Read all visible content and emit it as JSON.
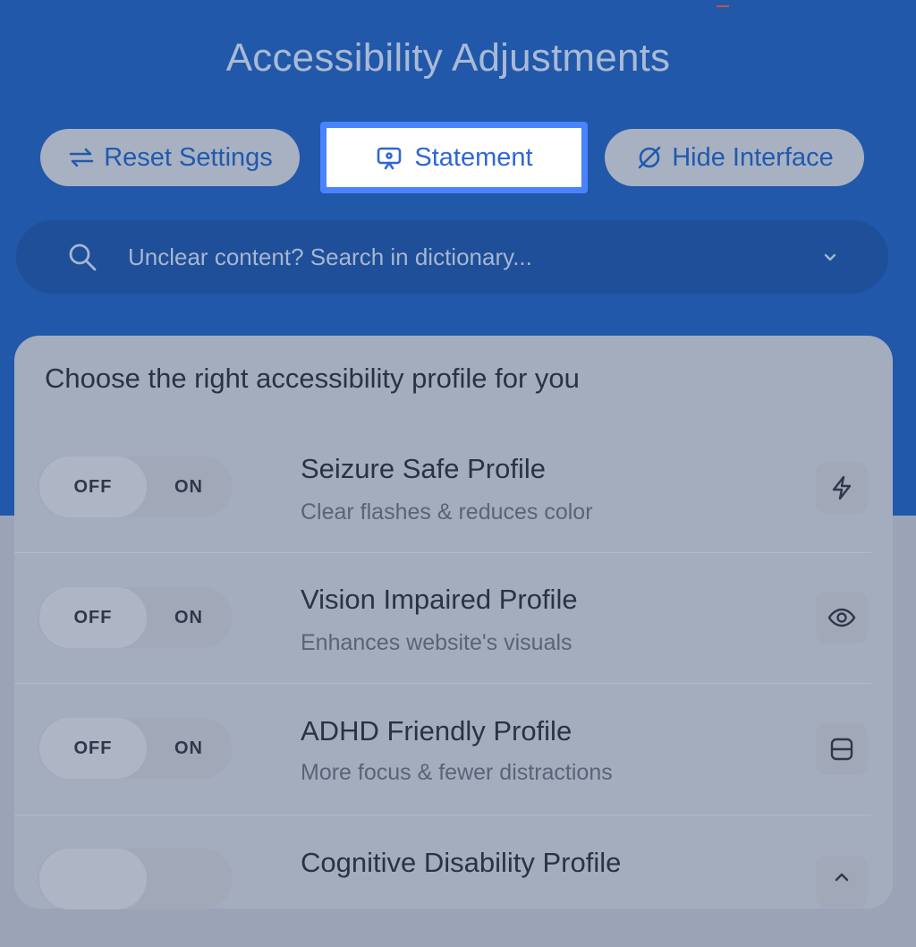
{
  "header": {
    "title": "Accessibility Adjustments",
    "buttons": {
      "reset": "Reset Settings",
      "statement": "Statement",
      "hide": "Hide Interface"
    }
  },
  "search": {
    "placeholder": "Unclear content? Search in dictionary..."
  },
  "profiles": {
    "heading": "Choose the right accessibility profile for you",
    "toggle_off": "OFF",
    "toggle_on": "ON",
    "items": [
      {
        "name": "Seizure Safe Profile",
        "description": "Clear flashes & reduces color",
        "icon": "lightning-icon"
      },
      {
        "name": "Vision Impaired Profile",
        "description": "Enhances website's visuals",
        "icon": "eye-icon"
      },
      {
        "name": "ADHD Friendly Profile",
        "description": "More focus & fewer distractions",
        "icon": "split-square-icon"
      },
      {
        "name": "Cognitive Disability Profile",
        "description": "",
        "icon": "chevron-up-icon"
      }
    ]
  },
  "colors": {
    "header_bg": "#2158a9",
    "accent": "#4a83ff",
    "button_text": "#1f5ab0"
  }
}
